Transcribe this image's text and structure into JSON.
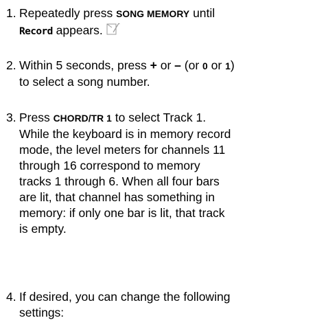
{
  "steps": [
    {
      "number": "1.",
      "parts": {
        "a": "Repeatedly press ",
        "key": "SONG MEMORY",
        "b": " until",
        "display": "Record",
        "c": " appears."
      },
      "icon": "note-pencil-icon"
    },
    {
      "number": "2.",
      "parts": {
        "a": "Within 5 seconds, press ",
        "plus": "+",
        "b": " or ",
        "minus": "–",
        "c": " (or ",
        "zero": "0",
        "d": " or ",
        "one": "1",
        "e": ")",
        "f": "to select a song number."
      }
    },
    {
      "number": "3.",
      "parts": {
        "a": "Press ",
        "key": "CHORD/TR 1",
        "b": " to select Track 1.",
        "line2": "While the keyboard is in memory record",
        "line3": "mode, the level meters for channels 11",
        "line4": "through 16 correspond to memory",
        "line5": "tracks 1 through 6. When all four bars",
        "line6": "are lit, that channel has something in",
        "line7": "memory: if only one bar is lit, that track",
        "line8": "is empty."
      }
    },
    {
      "number": "4.",
      "parts": {
        "line1": "If desired, you can change the following",
        "line2": "settings:"
      }
    }
  ]
}
